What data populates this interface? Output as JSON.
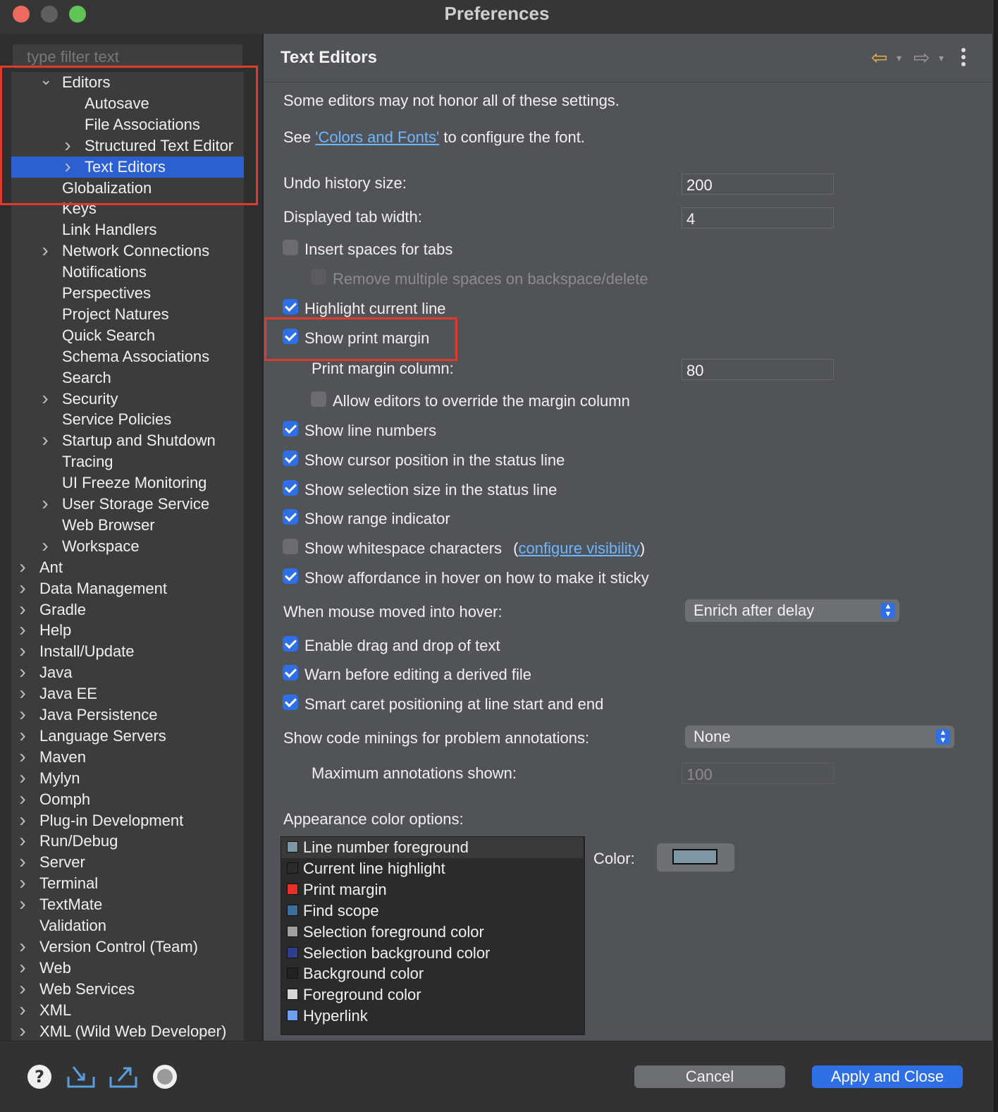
{
  "window": {
    "title": "Preferences"
  },
  "filter": {
    "placeholder": "type filter text"
  },
  "tree": {
    "items": [
      {
        "label": "Editors",
        "chevron": "down"
      },
      {
        "label": "Autosave",
        "chevron": ""
      },
      {
        "label": "File Associations",
        "chevron": ""
      },
      {
        "label": "Structured Text Editor",
        "chevron": "right"
      },
      {
        "label": "Text Editors",
        "chevron": "right",
        "selected": true
      },
      {
        "label": "Globalization",
        "chevron": ""
      },
      {
        "label": "Keys",
        "chevron": ""
      },
      {
        "label": "Link Handlers",
        "chevron": ""
      },
      {
        "label": "Network Connections",
        "chevron": "right"
      },
      {
        "label": "Notifications",
        "chevron": ""
      },
      {
        "label": "Perspectives",
        "chevron": ""
      },
      {
        "label": "Project Natures",
        "chevron": ""
      },
      {
        "label": "Quick Search",
        "chevron": ""
      },
      {
        "label": "Schema Associations",
        "chevron": ""
      },
      {
        "label": "Search",
        "chevron": ""
      },
      {
        "label": "Security",
        "chevron": "right"
      },
      {
        "label": "Service Policies",
        "chevron": ""
      },
      {
        "label": "Startup and Shutdown",
        "chevron": "right"
      },
      {
        "label": "Tracing",
        "chevron": ""
      },
      {
        "label": "UI Freeze Monitoring",
        "chevron": ""
      },
      {
        "label": "User Storage Service",
        "chevron": "right"
      },
      {
        "label": "Web Browser",
        "chevron": ""
      },
      {
        "label": "Workspace",
        "chevron": "right"
      },
      {
        "label": "Ant",
        "chevron": "right"
      },
      {
        "label": "Data Management",
        "chevron": "right"
      },
      {
        "label": "Gradle",
        "chevron": "right"
      },
      {
        "label": "Help",
        "chevron": "right"
      },
      {
        "label": "Install/Update",
        "chevron": "right"
      },
      {
        "label": "Java",
        "chevron": "right"
      },
      {
        "label": "Java EE",
        "chevron": "right"
      },
      {
        "label": "Java Persistence",
        "chevron": "right"
      },
      {
        "label": "Language Servers",
        "chevron": "right"
      },
      {
        "label": "Maven",
        "chevron": "right"
      },
      {
        "label": "Mylyn",
        "chevron": "right"
      },
      {
        "label": "Oomph",
        "chevron": "right"
      },
      {
        "label": "Plug-in Development",
        "chevron": "right"
      },
      {
        "label": "Run/Debug",
        "chevron": "right"
      },
      {
        "label": "Server",
        "chevron": "right"
      },
      {
        "label": "Terminal",
        "chevron": "right"
      },
      {
        "label": "TextMate",
        "chevron": "right"
      },
      {
        "label": "Validation",
        "chevron": ""
      },
      {
        "label": "Version Control (Team)",
        "chevron": "right"
      },
      {
        "label": "Web",
        "chevron": "right"
      },
      {
        "label": "Web Services",
        "chevron": "right"
      },
      {
        "label": "XML",
        "chevron": "right"
      },
      {
        "label": "XML (Wild Web Developer)",
        "chevron": "right"
      }
    ]
  },
  "page": {
    "title": "Text Editors",
    "nav": {
      "back_icon": "back-arrow-icon",
      "forward_icon": "forward-arrow-icon",
      "menu_icon": "kebab-menu-icon"
    },
    "note": "Some editors may not honor all of these settings.",
    "see_prefix": "See",
    "see_link": "'Colors and Fonts'",
    "see_suffix": "to configure the font.",
    "undo_label": "Undo history size:",
    "undo_value": "200",
    "tabwidth_label": "Displayed tab width:",
    "tabwidth_value": "4",
    "insert_spaces": {
      "label": "Insert spaces for tabs",
      "checked": false
    },
    "remove_spaces": {
      "label": "Remove multiple spaces on backspace/delete",
      "checked": false,
      "enabled": false
    },
    "highlight_line": {
      "label": "Highlight current line",
      "checked": true
    },
    "print_margin": {
      "label": "Show print margin",
      "checked": true
    },
    "margin_col_label": "Print margin column:",
    "margin_col_value": "80",
    "allow_override": {
      "label": "Allow editors to override the margin column",
      "checked": false
    },
    "line_numbers": {
      "label": "Show line numbers",
      "checked": true
    },
    "cursor_pos": {
      "label": "Show cursor position in the status line",
      "checked": true
    },
    "selection_size": {
      "label": "Show selection size in the status line",
      "checked": true
    },
    "range_indicator": {
      "label": "Show range indicator",
      "checked": true
    },
    "whitespace": {
      "label": "Show whitespace characters",
      "checked": false,
      "paren_open": "(",
      "link": "configure visibility",
      "paren_close": ")"
    },
    "affordance": {
      "label": "Show affordance in hover on how to make it sticky",
      "checked": true
    },
    "hover_label": "When mouse moved into hover:",
    "hover_value": "Enrich after delay",
    "drag_drop": {
      "label": "Enable drag and drop of text",
      "checked": true
    },
    "warn_derived": {
      "label": "Warn before editing a derived file",
      "checked": true
    },
    "smart_caret": {
      "label": "Smart caret positioning at line start and end",
      "checked": true
    },
    "minings_label": "Show code minings for problem annotations:",
    "minings_value": "None",
    "max_annot_label": "Maximum annotations shown:",
    "max_annot_value": "100",
    "appearance_label": "Appearance color options:",
    "color_label": "Color:",
    "color_value": "#7e97a6",
    "color_options": [
      {
        "label": "Line number foreground",
        "color": "#7e97a6",
        "selected": true
      },
      {
        "label": "Current line highlight",
        "color": "#2b2b2b"
      },
      {
        "label": "Print margin",
        "color": "#e8302a"
      },
      {
        "label": "Find scope",
        "color": "#3a6fa0"
      },
      {
        "label": "Selection foreground color",
        "color": "#a0a0a0"
      },
      {
        "label": "Selection background color",
        "color": "#2f3e8c"
      },
      {
        "label": "Background color",
        "color": "#222222"
      },
      {
        "label": "Foreground color",
        "color": "#d6d6d6"
      },
      {
        "label": "Hyperlink",
        "color": "#6a9ff2"
      }
    ]
  },
  "footer": {
    "help_icon": "help-icon",
    "import_icon": "import-icon",
    "export_icon": "export-icon",
    "record_icon": "record-icon",
    "cancel": "Cancel",
    "apply_close": "Apply and Close"
  },
  "colors": {
    "accent": "#2f6fe6",
    "highlight_box": "#e03b2a",
    "link": "#6fb6ff"
  }
}
